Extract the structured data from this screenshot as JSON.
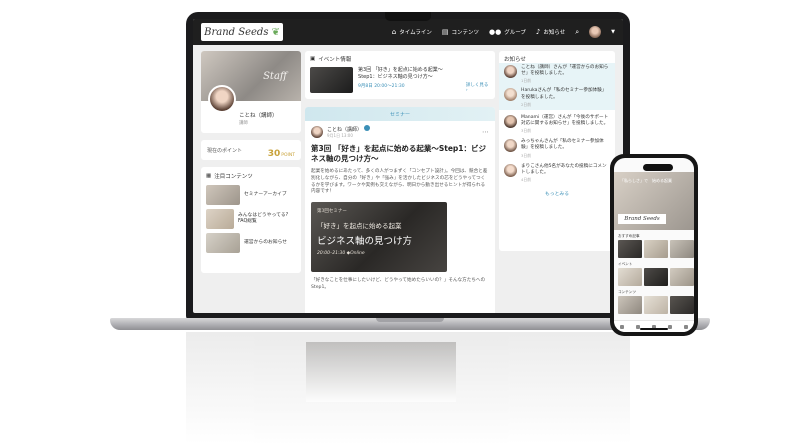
{
  "laptop": {
    "logo_text": "Brand Seeds",
    "nav": [
      {
        "icon": "home-icon",
        "label": "タイムライン"
      },
      {
        "icon": "book-icon",
        "label": "コンテンツ"
      },
      {
        "icon": "group-icon",
        "label": "グループ"
      },
      {
        "icon": "bell-icon",
        "label": "お知らせ"
      }
    ],
    "profile": {
      "cover_script": "Staff",
      "name": "ことね（講師）",
      "role": "講師"
    },
    "points": {
      "label": "現在のポイント",
      "value": "30",
      "unit": "POINT"
    },
    "featured": {
      "title": "注目コンテンツ",
      "items": [
        "セミナーアーカイブ",
        "みんなはどうやってる? FAQ総覧",
        "運営からのお知らせ"
      ]
    },
    "event": {
      "header": "イベント情報",
      "title": "第3回 「好き」を起点に始める起業〜Step1：ビジネス軸の見つけ方〜",
      "date": "9月8日 20:00〜21:30",
      "more": "詳しく見る ›"
    },
    "post": {
      "band_label": "セミナー",
      "author": "ことね（講師）",
      "time": "9月1日 13:00",
      "title": "第3回 「好き」を起点に始める起業〜Step1：ビジネス軸の見つけ方〜",
      "body": "起業を始めるにあたって、多くの人がつまずく「コンセプト設計」。今回は、競合と差別化しながら、自分の「好き」や「強み」を活かしたビジネスの芯をどうやってつくるかを学びます。ワークや実例も交えながら、明日から動き出せるヒントが得られる内容です！",
      "banner_small": "第3回セミナー",
      "banner_mid": "「好き」を起点に始める起業",
      "banner_big": "ビジネス軸の見つけ方",
      "banner_time": "20:00–21:30 ◆Online",
      "quote": "「好きなことを仕事にしたいけど、どうやって始めたらいいの？」そんな方たちへのStep1。"
    },
    "notifications": {
      "title": "お知らせ",
      "items": [
        {
          "text": "ことね（講師）さんが「運営からのお知らせ」を投稿しました。",
          "time": "1日前"
        },
        {
          "text": "Harukaさんが「私のセミナー参加体験」を投稿しました。",
          "time": "2日前"
        },
        {
          "text": "Manami（運営）さんが「今後のサポート対応に関するお知らせ」を投稿しました。",
          "time": "3日前"
        },
        {
          "text": "みっちゃんさんが「私のセミナー参加体験」を投稿しました。",
          "time": "3日前"
        },
        {
          "text": "まりこさん他5名があなたの投稿にコメントしました。",
          "time": "4日前"
        }
      ],
      "more": "もっとみる"
    }
  },
  "phone": {
    "hero_text": "「私らしさ」で　始める起業",
    "logo_text": "Brand Seeds",
    "section_1": "おすすめ記事",
    "section_2": "イベント",
    "section_3": "コンテンツ"
  },
  "colors": {
    "accent": "#3a8fb7",
    "points": "#c8a23a",
    "nav_bg": "#1f1f1f"
  }
}
